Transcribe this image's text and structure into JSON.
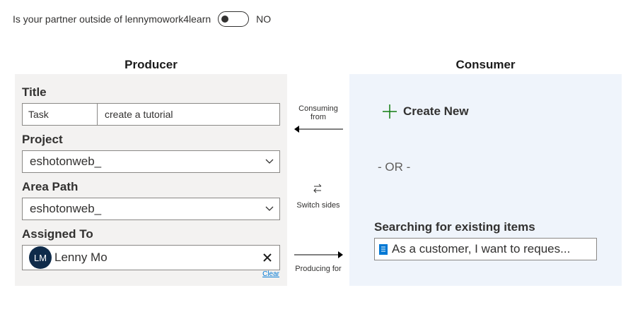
{
  "partner_toggle": {
    "label": "Is your partner outside of lennymowork4learn",
    "state": "NO"
  },
  "producer": {
    "heading": "Producer",
    "title_label": "Title",
    "title_type": "Task",
    "title_value": "create a tutorial",
    "project_label": "Project",
    "project_value": "eshotonweb_",
    "area_label": "Area Path",
    "area_value": "eshotonweb_",
    "assigned_label": "Assigned To",
    "assignee_initials": "LM",
    "assignee_name": "Lenny Mo",
    "clear_label": "Clear"
  },
  "middle": {
    "consuming_from": "Consuming from",
    "switch_sides": "Switch sides",
    "producing_for": "Producing for"
  },
  "consumer": {
    "heading": "Consumer",
    "create_new_label": "Create New",
    "or_label": "- OR -",
    "search_label": "Searching for existing items",
    "search_value": "As a customer, I want to reques..."
  },
  "colors": {
    "accent": "#0078d4",
    "plus_green": "#107c10",
    "avatar": "#0f2b4a",
    "producer_bg": "#f3f2f1",
    "consumer_bg": "#eff4fb"
  }
}
